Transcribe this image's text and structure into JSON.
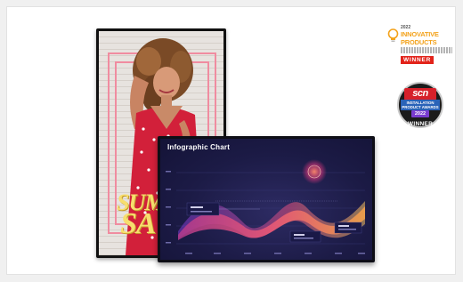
{
  "promo": {
    "sale_word_1": "SUM",
    "sale_word_2": "SA"
  },
  "infographic": {
    "title": "Infographic Chart"
  },
  "awards": {
    "innovative": {
      "year": "2022",
      "line1": "INNOVATIVE",
      "line2": "PRODUCTS",
      "badge": "WINNER"
    },
    "scn": {
      "logo": "scn",
      "line1": "INSTALLATION",
      "line2": "PRODUCT AWARDS",
      "year": "2022",
      "badge": "WINNER"
    }
  },
  "colors": {
    "accent_orange": "#f3a21b",
    "winner_red": "#e2231a",
    "scn_red": "#d6202a",
    "scn_purple": "#7a3bd0",
    "chart_bg": "#1c1b46",
    "sale_pink": "#f08ca0",
    "sale_yellow": "#f7de6e"
  },
  "icons": [
    "lightbulb-icon",
    "award-badge-icon"
  ]
}
